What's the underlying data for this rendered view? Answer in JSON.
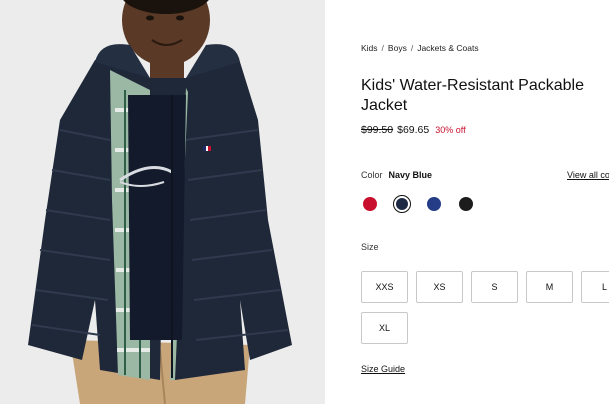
{
  "product_image": {
    "alt": "",
    "icon": "product-photo"
  },
  "breadcrumb": {
    "items": [
      "Kids",
      "Boys",
      "Jackets & Coats"
    ],
    "separator": "/"
  },
  "product": {
    "title": "Kids' Water-Resistant Packable Jacket",
    "price_original": "$99.50",
    "price_sale": "$69.65",
    "discount": "30% off"
  },
  "color": {
    "label": "Color",
    "selected": "Navy Blue",
    "view_all": "View all co",
    "swatches": [
      {
        "name": "red",
        "hex": "#c8102e",
        "selected": false
      },
      {
        "name": "navy",
        "hex": "#1e2a44",
        "selected": true
      },
      {
        "name": "blue",
        "hex": "#253c87",
        "selected": false
      },
      {
        "name": "black",
        "hex": "#1c1c1c",
        "selected": false
      }
    ]
  },
  "size": {
    "label": "Size",
    "options": [
      "XXS",
      "XS",
      "S",
      "M",
      "L",
      "XL"
    ],
    "guide": "Size Guide"
  },
  "colors": {
    "sale": "#c8102e",
    "text": "#111111",
    "border": "#c8c8c8"
  }
}
